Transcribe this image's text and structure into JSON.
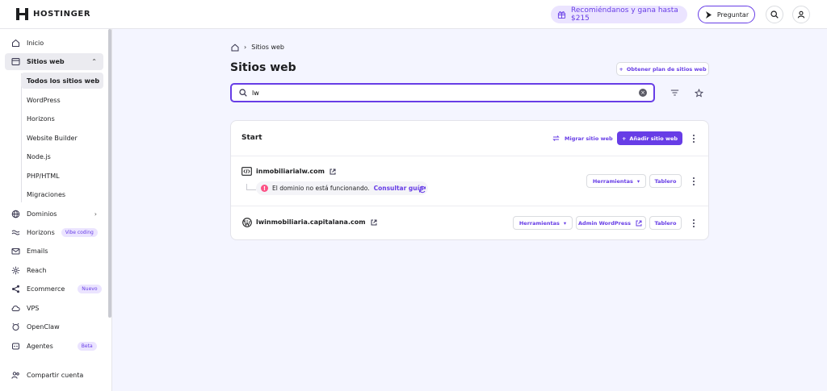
{
  "brand": {
    "name": "HOSTINGER"
  },
  "header": {
    "promo_label": "Recomiéndanos y gana hasta $215",
    "ask_label": "Preguntar"
  },
  "sidebar": {
    "items": [
      {
        "label": "Inicio",
        "icon": "home-icon"
      },
      {
        "label": "Sitios web",
        "icon": "window-icon"
      },
      {
        "label": "Dominios",
        "icon": "globe-icon"
      },
      {
        "label": "Horizons",
        "icon": "horizons-icon",
        "badge": "Vibe coding"
      },
      {
        "label": "Emails",
        "icon": "mail-icon"
      },
      {
        "label": "Reach",
        "icon": "reach-icon"
      },
      {
        "label": "Ecommerce",
        "icon": "share-icon",
        "badge": "Nuevo"
      },
      {
        "label": "VPS",
        "icon": "cloud-icon"
      },
      {
        "label": "OpenClaw",
        "icon": "claw-icon"
      },
      {
        "label": "Agentes",
        "icon": "agent-icon",
        "badge": "Beta"
      },
      {
        "label": "Compartir cuenta",
        "icon": "users-icon"
      }
    ],
    "subitems": [
      "Todos los sitios web",
      "WordPress",
      "Horizons",
      "Website Builder",
      "Node.js",
      "PHP/HTML",
      "Migraciones"
    ]
  },
  "main": {
    "breadcrumb": "Sitios web",
    "title": "Sitios web",
    "plan_button": "Obtener plan de sitios web",
    "search_value": "lw",
    "group": {
      "label": "Start",
      "migrate_label": "Migrar sitio web",
      "add_label": "Añadir sitio web"
    },
    "sites": [
      {
        "domain": "inmobiliarialw.com",
        "warning": "El dominio no está funcionando.",
        "warning_link": "Consultar guía",
        "tools_label": "Herramientas",
        "dashboard_label": "Tablero"
      },
      {
        "domain": "lwinmobiliaria.capitalana.com",
        "tools_label": "Herramientas",
        "admin_label": "Admin WordPress",
        "dashboard_label": "Tablero"
      }
    ]
  },
  "colors": {
    "accent": "#673de6",
    "warning": "#fc5185",
    "background": "#f4f5ff"
  }
}
